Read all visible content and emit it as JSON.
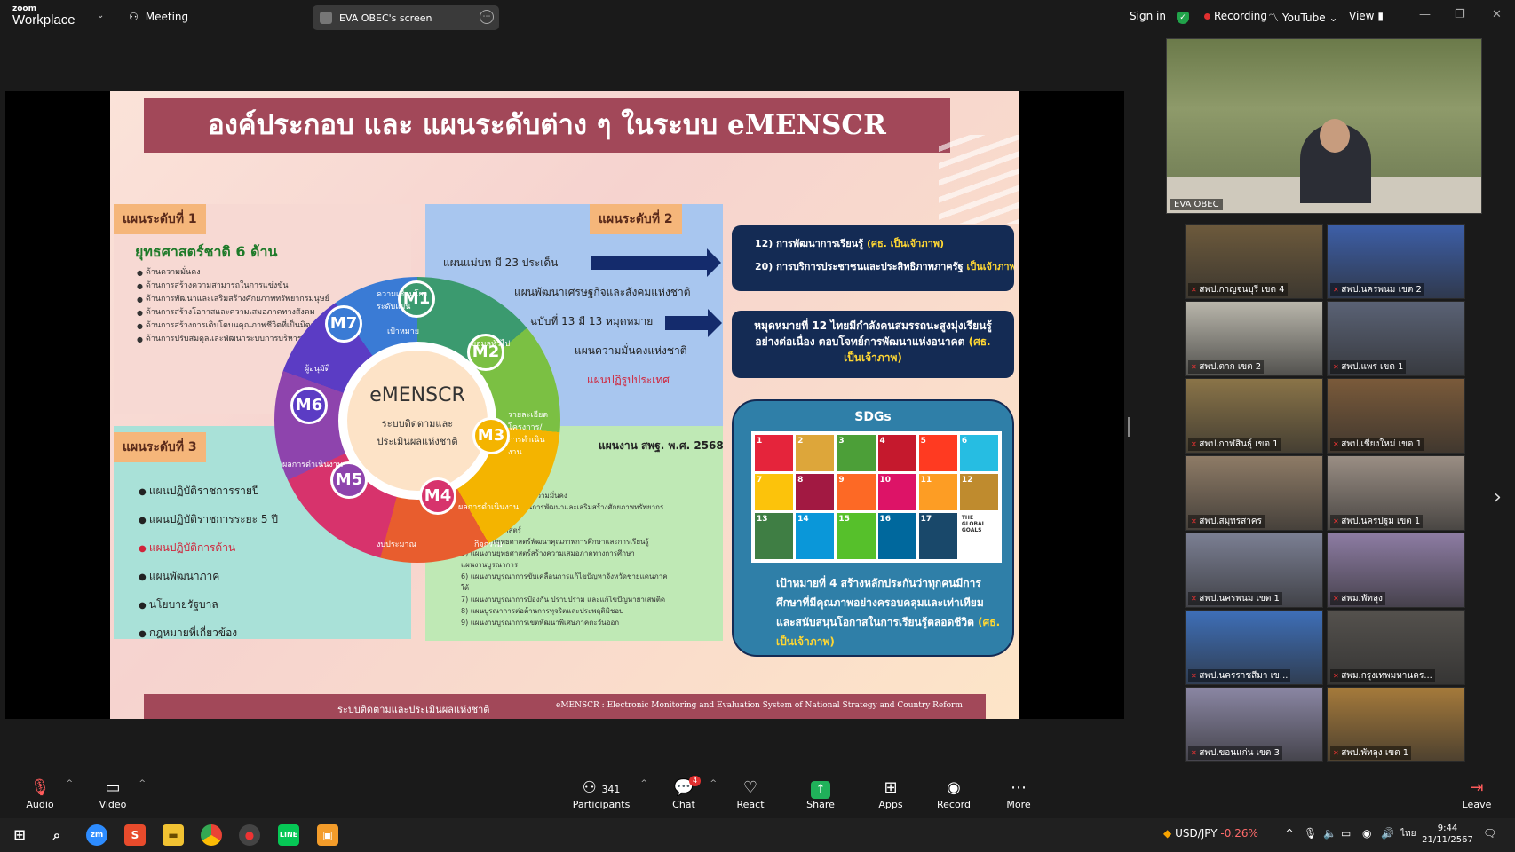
{
  "app": {
    "logo_top": "zoom",
    "logo_bottom": "Workplace",
    "meeting_label": "Meeting",
    "screen_tab_label": "EVA OBEC's screen",
    "sign_in": "Sign in",
    "recording": "Recording",
    "youtube": "YouTube",
    "view": "View"
  },
  "slide": {
    "title": "องค์ประกอบ และ แผนระดับต่าง ๆ ในระบบ eMENSCR",
    "level1_label": "แผนระดับที่ 1",
    "level1_heading": "ยุทธศาสตร์ชาติ 6 ด้าน",
    "level1_items": [
      "ด้านความมั่นคง",
      "ด้านการสร้างความสามารถในการแข่งขัน",
      "ด้านการพัฒนาและเสริมสร้างศักยภาพทรัพยากรมนุษย์",
      "ด้านการสร้างโอกาสและความเสมอภาคทางสังคม",
      "ด้านการสร้างการเติบโตบนคุณภาพชีวิตที่เป็นมิตรต่อสิ่งแวดล้อม",
      "ด้านการปรับสมดุลและพัฒนาระบบการบริหารจัดการภาครัฐ"
    ],
    "level2_label": "แผนระดับที่ 2",
    "level2_items": [
      {
        "text": "แผนแม่บท มี 23 ประเด็น"
      },
      {
        "text": "แผนพัฒนาเศรษฐกิจและสังคมแห่งชาติ"
      },
      {
        "text": "ฉบับที่ 13 มี 13 หมุดหมาย"
      },
      {
        "text": "แผนความมั่นคงแห่งชาติ"
      },
      {
        "text": "แผนปฏิรูปประเทศ"
      }
    ],
    "level3_label": "แผนระดับที่ 3",
    "level3_items": [
      "แผนปฏิบัติราชการรายปี",
      "แผนปฏิบัติราชการระยะ 5 ปี",
      "แผนปฏิบัติการด้าน",
      "แผนพัฒนาภาค",
      "นโยบายรัฐบาล",
      "กฎหมายที่เกี่ยวข้อง"
    ],
    "plan_label": "แผนงาน สพฐ. พ.ศ. 2568",
    "plan_items": [
      "1) แผนงานบุคลากรภาครัฐ",
      "แผนงานพื้นฐาน",
      "2) แผนงานพื้นฐานด้านความมั่นคง",
      "3) แผนงานพื้นฐานด้านการพัฒนาและเสริมสร้างศักยภาพทรัพยากรมนุษย์",
      "แผนงานยุทธศาสตร์",
      "4) แผนงานยุทธศาสตร์พัฒนาคุณภาพการศึกษาและการเรียนรู้",
      "5) แผนงานยุทธศาสตร์สร้างความเสมอภาคทางการศึกษา",
      "แผนงานบูรณาการ",
      "6) แผนงานบูรณาการขับเคลื่อนการแก้ไขปัญหาจังหวัดชายแดนภาคใต้",
      "7) แผนงานบูรณาการป้องกัน ปราบปราม และแก้ไขปัญหายาเสพติด",
      "8) แผนบูรณาการต่อต้านการทุจริตและประพฤติมิชอบ",
      "9) แผนงานบูรณาการเขตพัฒนาพิเศษภาคตะวันออก"
    ],
    "wheel_center_title": "eMENSCR",
    "wheel_center_sub1": "ระบบติดตามและ",
    "wheel_center_sub2": "ประเมินผลแห่งชาติ",
    "wheel_nodes": [
      "M1",
      "M2",
      "M3",
      "M4",
      "M5",
      "M6",
      "M7"
    ],
    "wheel_labels": [
      "ความเชื่อมโยงระดับแผน",
      "เป้าหมาย",
      "ข้อมูลทั่วไป",
      "รายละเอียดโครงการ/การดำเนินงาน",
      "ผลการดำเนินงาน",
      "กิจกรรม",
      "งบประมาณ",
      "ผลการดำเนินงาน",
      "ผู้อนุมัติ"
    ],
    "goal12_line1": "12) การพัฒนาการเรียนรู้",
    "goal12_line1_tag": "(ศธ. เป็นเจ้าภาพ)",
    "goal12_line2": "20) การบริการประชาชนและประสิทธิภาพภาครัฐ",
    "goal12_line2_tag": "เป็นเจ้าภาพ",
    "milestone_text": "หมุดหมายที่ 12 ไทยมีกำลังคนสมรรถนะสูงมุ่งเรียนรู้อย่างต่อเนื่อง ตอบโจทย์การพัฒนาแห่งอนาคต",
    "milestone_tag": "(ศธ. เป็นเจ้าภาพ)",
    "sdgs_title": "SDGs",
    "sdg_numbers": [
      "1",
      "2",
      "3",
      "4",
      "5",
      "6",
      "7",
      "8",
      "9",
      "10",
      "11",
      "12",
      "13",
      "14",
      "15",
      "16",
      "17",
      "THE GLOBAL GOALS"
    ],
    "sdg_colors": [
      "#e5243b",
      "#dda63a",
      "#4c9f38",
      "#c5192d",
      "#ff3a21",
      "#26bde2",
      "#fcc30b",
      "#a21942",
      "#fd6925",
      "#dd1367",
      "#fd9d24",
      "#bf8b2e",
      "#3f7e44",
      "#0a97d9",
      "#56c02b",
      "#00689d",
      "#19486a",
      "#ffffff"
    ],
    "sdg_goal_text": "เป้าหมายที่ 4 สร้างหลักประกันว่าทุกคนมีการศึกษาที่มีคุณภาพอย่างครอบคลุมและเท่าเทียม และสนับสนุนโอกาสในการเรียนรู้ตลอดชีวิต",
    "sdg_goal_tag": "(ศธ. เป็นเจ้าภาพ)",
    "footer_left": "ระบบติดตามและประเมินผลแห่งชาติ",
    "footer_right": "eMENSCR : Electronic Monitoring and Evaluation System of National Strategy and Country Reform"
  },
  "speaker": {
    "name": "EVA OBEC"
  },
  "tiles": [
    {
      "name": "สพป.กาญจนบุรี เขต 4",
      "color": "#6d5a3c"
    },
    {
      "name": "สพป.นครพนม เขต 2",
      "color": "#3d5fa8"
    },
    {
      "name": "สพป.ตาก เขต 2",
      "color": "#b9b6ab"
    },
    {
      "name": "สพป.แพร่ เขต 1",
      "color": "#5a6275"
    },
    {
      "name": "สพป.กาฬสินธุ์ เขต 1",
      "color": "#8a7448"
    },
    {
      "name": "สพป.เชียงใหม่ เขต 1",
      "color": "#7a5a3a"
    },
    {
      "name": "สพป.สมุทรสาคร",
      "color": "#8e7b66"
    },
    {
      "name": "สพป.นครปฐม เขต 1",
      "color": "#9a8e84"
    },
    {
      "name": "สพป.นครพนม เขต 1",
      "color": "#7b7f93"
    },
    {
      "name": "สพม.พัทลุง",
      "color": "#8d7ca3"
    },
    {
      "name": "สพป.นครราชสีมา เข...",
      "color": "#3e6fb8"
    },
    {
      "name": "สพม.กรุงเทพมหานคร...",
      "color": "#54514d"
    },
    {
      "name": "สพป.ขอนแก่น เขต 3",
      "color": "#8a86a3"
    },
    {
      "name": "สพป.พัทลุง เขต 1",
      "color": "#a57a3b"
    }
  ],
  "toolbar": {
    "audio": "Audio",
    "video": "Video",
    "participants": "Participants",
    "participants_count": "341",
    "chat": "Chat",
    "chat_badge": "4",
    "react": "React",
    "share": "Share",
    "apps": "Apps",
    "record": "Record",
    "more": "More",
    "leave": "Leave"
  },
  "taskbar": {
    "currency": "USD/JPY",
    "currency_change": "-0.26%",
    "lang": "ไทย",
    "time": "9:44",
    "date": "21/11/2567"
  }
}
